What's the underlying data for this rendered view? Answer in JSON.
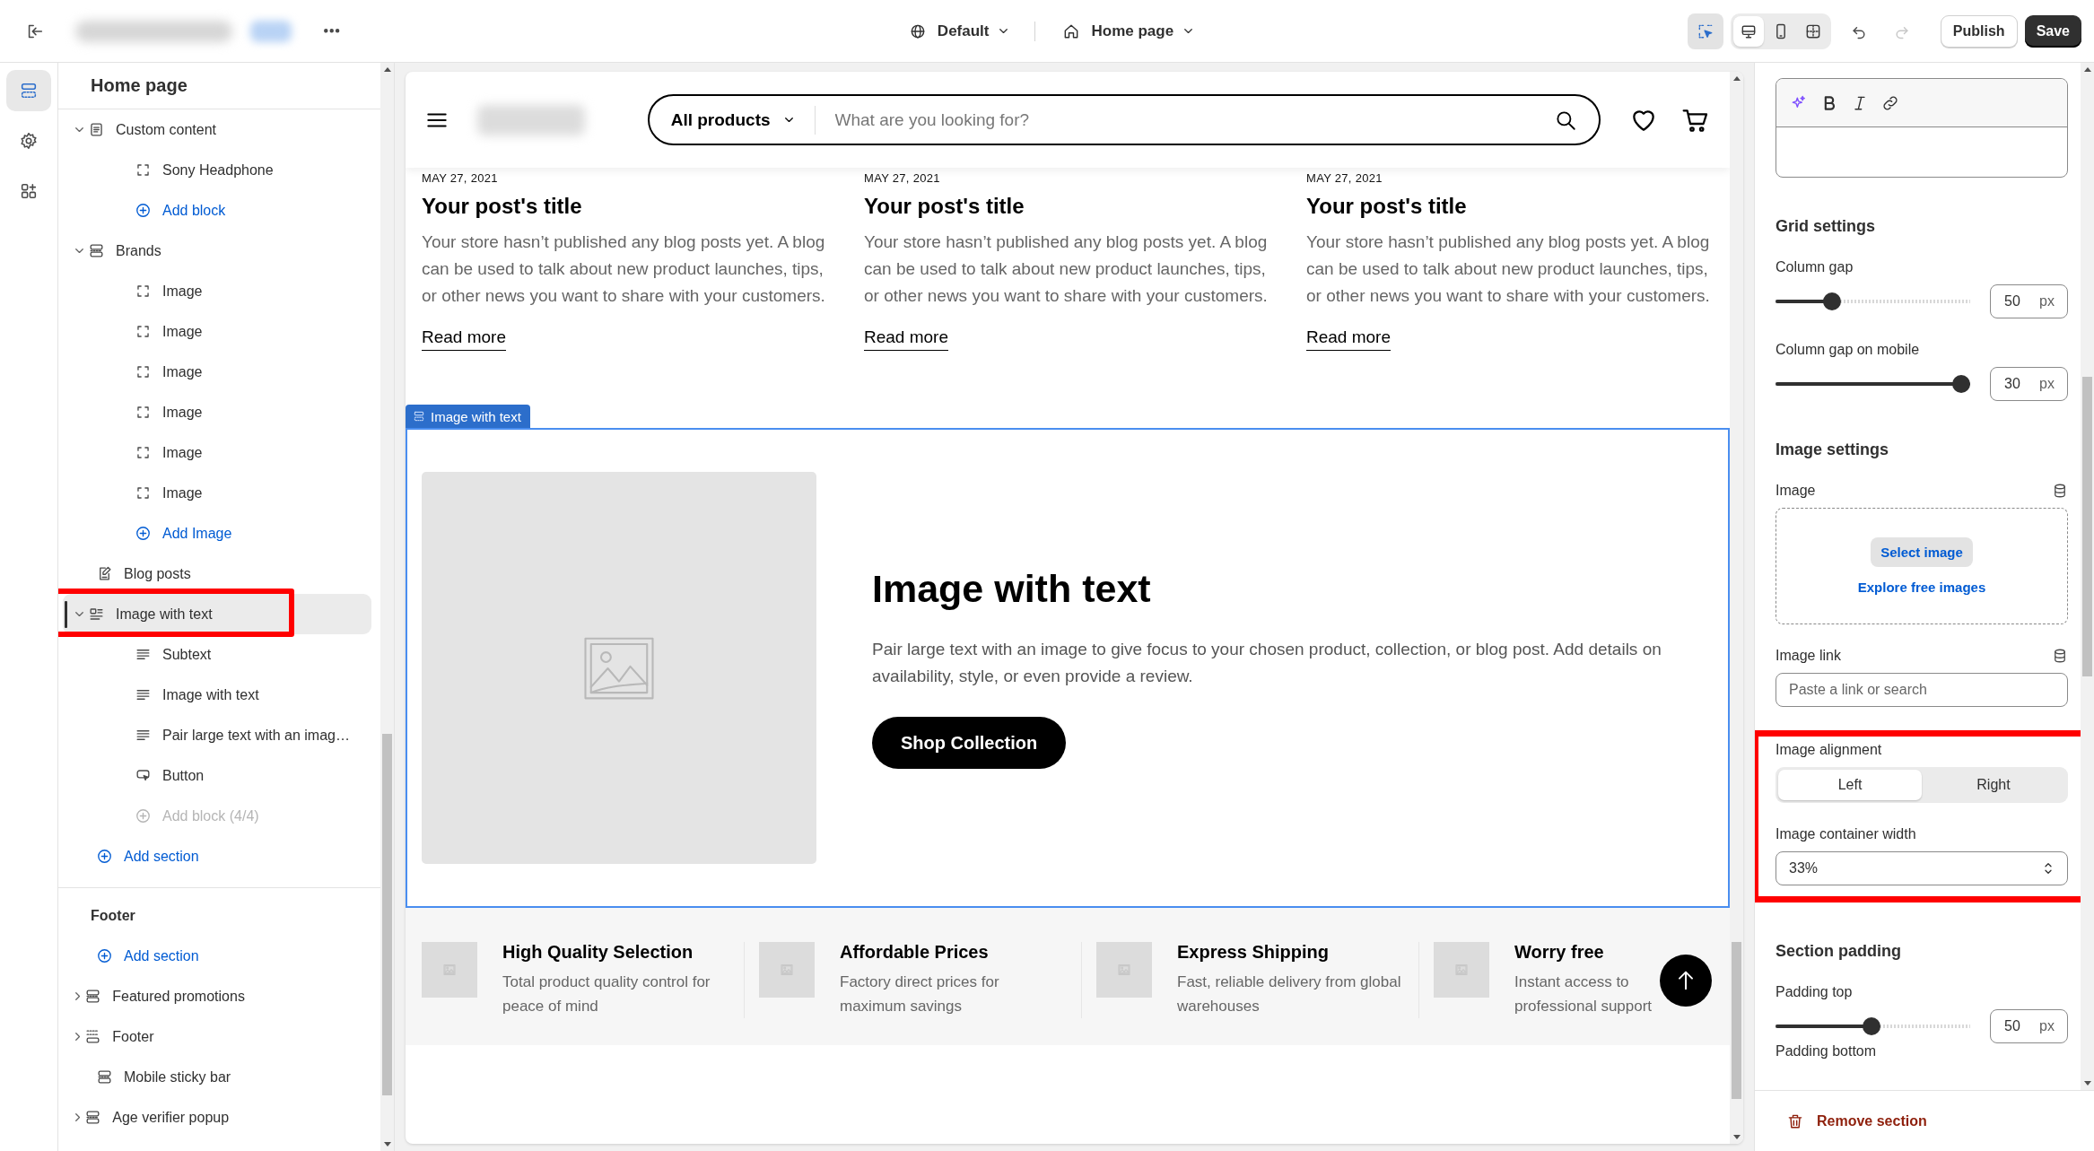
{
  "topbar": {
    "view": "Default",
    "page": "Home page",
    "inspector": {
      "selected": true
    },
    "devices": [
      {
        "kind": "desktop",
        "selected": true
      },
      {
        "kind": "mobile",
        "selected": false
      },
      {
        "kind": "fullscreen",
        "selected": false
      }
    ],
    "history": [
      {
        "kind": "undo",
        "disabled": false
      },
      {
        "kind": "redo",
        "disabled": true
      }
    ],
    "buttons": [
      {
        "label": "Publish",
        "kind": "secondary"
      },
      {
        "label": "Save",
        "kind": "primary"
      }
    ]
  },
  "rail": [
    {
      "kind": "sections",
      "selected": true
    },
    {
      "kind": "settings",
      "selected": false
    },
    {
      "kind": "apps",
      "selected": false
    }
  ],
  "tree": {
    "title": "Home page",
    "items": [
      {
        "label": "Custom content",
        "kind": "content",
        "expanded": true,
        "selected": false,
        "children": [
          {
            "label": "Sony Headphone",
            "kind": "block",
            "selected": false
          },
          {
            "label": "Add block",
            "kind": "add",
            "selected": false
          }
        ]
      },
      {
        "label": "Brands",
        "kind": "section",
        "expanded": true,
        "selected": false,
        "children": [
          {
            "label": "Image",
            "kind": "block",
            "selected": false
          },
          {
            "label": "Image",
            "kind": "block",
            "selected": false
          },
          {
            "label": "Image",
            "kind": "block",
            "selected": false
          },
          {
            "label": "Image",
            "kind": "block",
            "selected": false
          },
          {
            "label": "Image",
            "kind": "block",
            "selected": false
          },
          {
            "label": "Image",
            "kind": "block",
            "selected": false
          },
          {
            "label": "Add Image",
            "kind": "add",
            "selected": false
          }
        ]
      },
      {
        "label": "Blog posts",
        "kind": "blog",
        "selected": false
      },
      {
        "label": "Image with text",
        "kind": "media-text",
        "expanded": true,
        "selected": true,
        "highlighted": true,
        "children": [
          {
            "label": "Subtext",
            "kind": "text",
            "selected": false
          },
          {
            "label": "Image with text",
            "kind": "text",
            "selected": false
          },
          {
            "label": "Pair large text with an imag…",
            "kind": "text",
            "selected": false
          },
          {
            "label": "Button",
            "kind": "button",
            "selected": false
          },
          {
            "label": "Add block (4/4)",
            "kind": "add",
            "selected": false,
            "disabled": true
          }
        ]
      },
      {
        "label": "Add section",
        "kind": "add",
        "selected": false
      }
    ]
  },
  "footer_group": {
    "title": "Footer",
    "items": [
      {
        "label": "Add section",
        "kind": "add",
        "selected": false
      },
      {
        "label": "Featured promotions",
        "kind": "section",
        "expanded": false,
        "selected": false
      },
      {
        "label": "Footer",
        "kind": "footer",
        "expanded": false,
        "selected": false
      },
      {
        "label": "Mobile sticky bar",
        "kind": "section",
        "selected": false
      },
      {
        "label": "Age verifier popup",
        "kind": "section",
        "expanded": false,
        "selected": false
      }
    ]
  },
  "preview": {
    "search": {
      "category": "All products",
      "placeholder": "What are you looking for?"
    },
    "posts": [
      {
        "date": "MAY 27, 2021",
        "title": "Your post's title",
        "excerpt": "Your store hasn’t published any blog posts yet. A blog can be used to talk about new product launches, tips, or other news you want to share with your customers.",
        "link": "Read more"
      },
      {
        "date": "MAY 27, 2021",
        "title": "Your post's title",
        "excerpt": "Your store hasn’t published any blog posts yet. A blog can be used to talk about new product launches, tips, or other news you want to share with your customers.",
        "link": "Read more"
      },
      {
        "date": "MAY 27, 2021",
        "title": "Your post's title",
        "excerpt": "Your store hasn’t published any blog posts yet. A blog can be used to talk about new product launches, tips, or other news you want to share with your customers.",
        "link": "Read more"
      }
    ],
    "section_tag": "Image with text",
    "image_with_text": {
      "heading": "Image with text",
      "text": "Pair large text with an image to give focus to your chosen product, collection, or blog post. Add details on availability, style, or even provide a review.",
      "button": "Shop Collection"
    },
    "features": [
      {
        "title": "High Quality Selection",
        "text": "Total product quality control for peace of mind"
      },
      {
        "title": "Affordable Prices",
        "text": "Factory direct prices for maximum savings"
      },
      {
        "title": "Express Shipping",
        "text": "Fast, reliable delivery from global warehouses"
      },
      {
        "title": "Worry free",
        "text": "Instant access to professional support"
      }
    ]
  },
  "settings": {
    "items": [
      {
        "kind": "richtext"
      },
      {
        "kind": "heading",
        "label": "Grid settings"
      },
      {
        "kind": "slider",
        "label": "Column gap",
        "level": 0.27,
        "value": "50",
        "unit": "px"
      },
      {
        "kind": "slider",
        "label": "Column gap on mobile",
        "level": 1,
        "value": "30",
        "unit": "px"
      },
      {
        "kind": "heading",
        "label": "Image settings"
      },
      {
        "kind": "image-picker",
        "label": "Image",
        "button": "Select image",
        "link": "Explore free images"
      },
      {
        "kind": "text-field",
        "label": "Image link",
        "placeholder": "Paste a link or search"
      },
      {
        "kind": "group",
        "highlighted": true,
        "items": [
          {
            "kind": "segmented",
            "label": "Image alignment",
            "options": [
              {
                "label": "Left",
                "selected": true
              },
              {
                "label": "Right",
                "selected": false
              }
            ]
          },
          {
            "kind": "select",
            "label": "Image container width",
            "value": "33%"
          }
        ]
      },
      {
        "kind": "heading",
        "label": "Section padding"
      },
      {
        "kind": "slider",
        "label": "Padding top",
        "level": 0.49,
        "value": "50",
        "unit": "px"
      },
      {
        "kind": "label",
        "label": "Padding bottom"
      }
    ],
    "remove": "Remove section"
  }
}
